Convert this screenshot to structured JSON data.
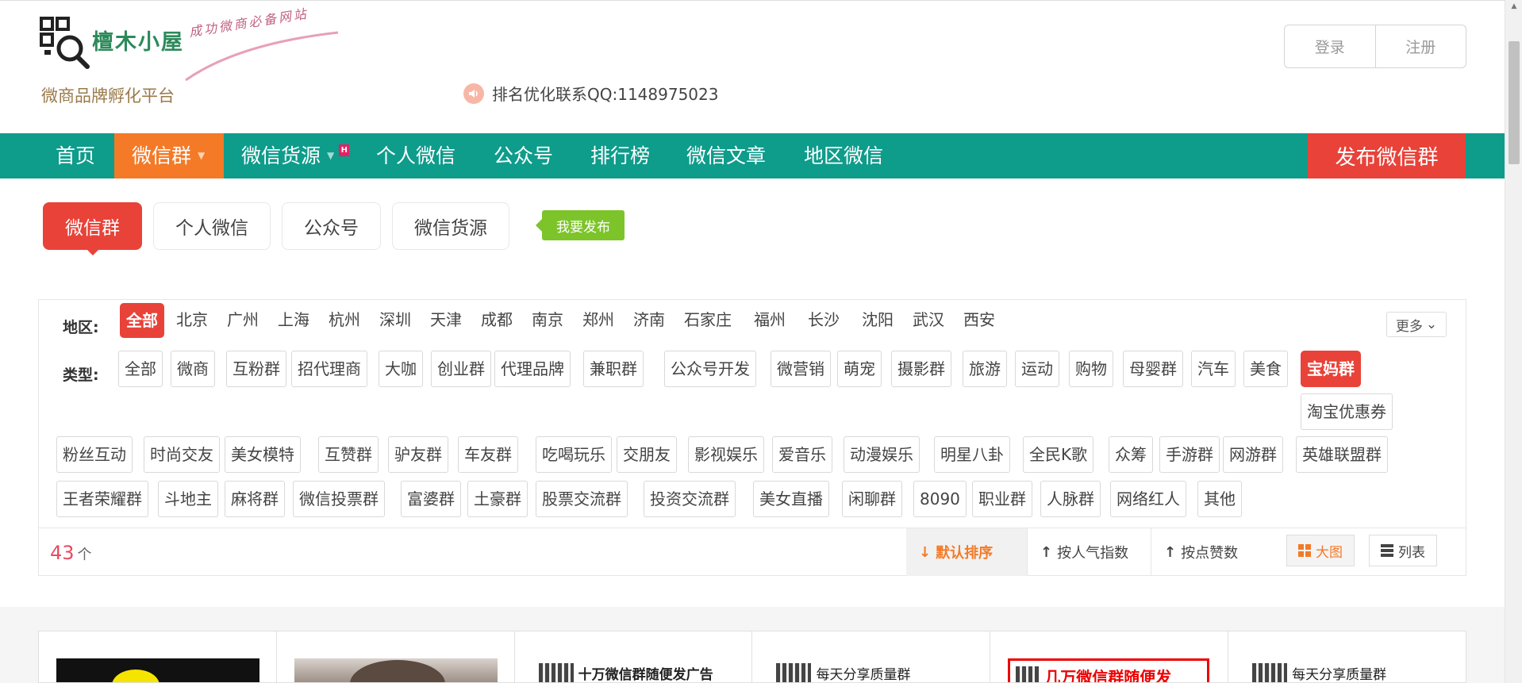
{
  "header": {
    "logo_name": "檀木小屋",
    "logo_slogan": "成功微商必备网站",
    "subtitle": "微商品牌孵化平台",
    "contact": "排名优化联系QQ:1148975023",
    "login": "登录",
    "register": "注册"
  },
  "nav": {
    "items": [
      "首页",
      "微信群",
      "微信货源",
      "个人微信",
      "公众号",
      "排行榜",
      "微信文章",
      "地区微信"
    ],
    "hot_badge": "H",
    "publish": "发布微信群"
  },
  "tabs": {
    "items": [
      "微信群",
      "个人微信",
      "公众号",
      "微信货源"
    ],
    "post_tag": "我要发布"
  },
  "filter": {
    "region_label": "地区:",
    "regions": [
      "全部",
      "北京",
      "广州",
      "上海",
      "杭州",
      "深圳",
      "天津",
      "成都",
      "南京",
      "郑州",
      "济南",
      "石家庄",
      "福州",
      "长沙",
      "沈阳",
      "武汉",
      "西安"
    ],
    "more": "更多",
    "type_label": "类型:",
    "types": [
      "全部",
      "微商",
      "互粉群",
      "招代理商",
      "大咖",
      "创业群",
      "代理品牌",
      "兼职群",
      "公众号开发",
      "微营销",
      "萌宠",
      "摄影群",
      "旅游",
      "运动",
      "购物",
      "母婴群",
      "汽车",
      "美食",
      "宝妈群",
      "淘宝优惠券",
      "粉丝互动",
      "时尚交友",
      "美女模特",
      "互赞群",
      "驴友群",
      "车友群",
      "吃喝玩乐",
      "交朋友",
      "影视娱乐",
      "爱音乐",
      "动漫娱乐",
      "明星八卦",
      "全民K歌",
      "众筹",
      "手游群",
      "网游群",
      "英雄联盟群",
      "王者荣耀群",
      "斗地主",
      "麻将群",
      "微信投票群",
      "富婆群",
      "土豪群",
      "股票交流群",
      "投资交流群",
      "美女直播",
      "闲聊群",
      "8090",
      "职业群",
      "人脉群",
      "网络红人",
      "其他"
    ]
  },
  "results": {
    "count": "43",
    "unit": "个",
    "sort_default": "默认排序",
    "sort_popularity": "按人气指数",
    "sort_likes": "按点赞数",
    "view_grid": "大图",
    "view_list": "列表"
  },
  "cards": {
    "titles": [
      "",
      "",
      "十万微信群随便发广告",
      "每天分享质量群",
      "几万微信群随便发",
      "每天分享质量群"
    ]
  },
  "colors": {
    "nav_bg": "#0e9c8b",
    "active_orange": "#f47a27",
    "accent_red": "#e84239",
    "post_green": "#7dc42a"
  }
}
